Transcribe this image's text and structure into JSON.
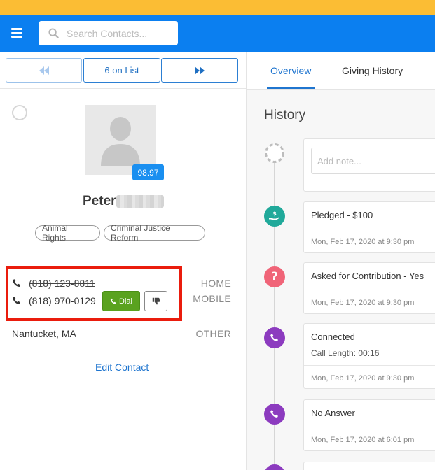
{
  "colors": {
    "brand": "#0b7ff0",
    "accent_strip": "#fbbd34",
    "highlight": "#ea1c0d",
    "dial": "#5aa21f",
    "pledge": "#20a99a",
    "question": "#f06478",
    "call": "#8c3bbf"
  },
  "header": {
    "menu_icon": "hamburger-icon",
    "search": {
      "placeholder": "Search Contacts...",
      "value": "",
      "icon": "search-icon"
    }
  },
  "list_nav": {
    "prev_icon": "rewind-icon",
    "count_label": "6 on List",
    "next_icon": "fast-forward-icon"
  },
  "contact": {
    "avatar_icon": "person-icon",
    "score": "98.97",
    "first_name": "Peter",
    "tags": [
      "Animal Rights",
      "Criminal Justice Reform"
    ],
    "phones": [
      {
        "number": "(818) 123-8811",
        "type": "HOME",
        "struck": true
      },
      {
        "number": "(818) 970-0129",
        "type": "MOBILE",
        "struck": false
      }
    ],
    "dial_label": "Dial",
    "address": "Nantucket, MA",
    "address_type": "OTHER",
    "edit_label": "Edit Contact"
  },
  "tabs": [
    {
      "label": "Overview",
      "active": true
    },
    {
      "label": "Giving History",
      "active": false
    }
  ],
  "history": {
    "title": "History",
    "note_placeholder": "Add note...",
    "items": [
      {
        "icon": "hand-dollar-icon",
        "title": "Pledged - $100",
        "date": "Mon, Feb 17, 2020 at 9:30 pm"
      },
      {
        "icon": "question-icon",
        "title": "Asked for Contribution - Yes",
        "date": "Mon, Feb 17, 2020 at 9:30 pm"
      },
      {
        "icon": "phone-icon",
        "title": "Connected",
        "sub": "Call Length: 00:16",
        "date": "Mon, Feb 17, 2020 at 9:30 pm"
      },
      {
        "icon": "phone-icon",
        "title": "No Answer",
        "date": "Mon, Feb 17, 2020 at 6:01 pm"
      }
    ]
  }
}
